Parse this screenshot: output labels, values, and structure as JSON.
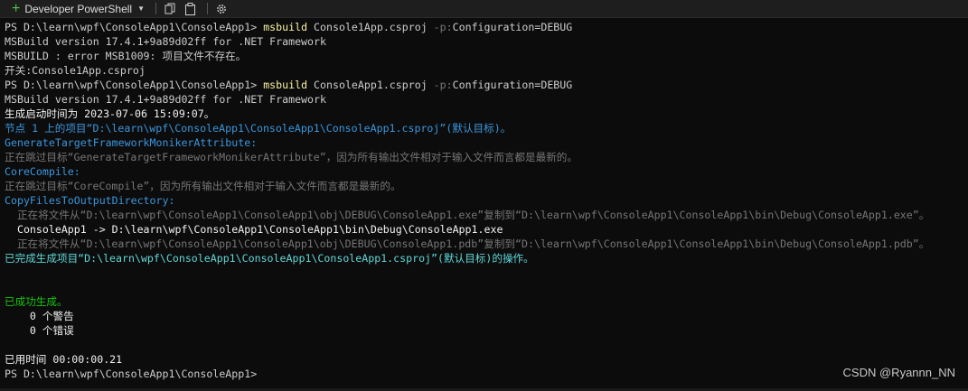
{
  "toolbar": {
    "new_tab_icon": "plus-icon",
    "profile_name": "Developer PowerShell",
    "dropdown_icon": "chevron-down-icon",
    "copy_icon": "copy-icon",
    "paste_icon": "paste-icon",
    "settings_icon": "gear-icon"
  },
  "terminal": {
    "lines": [
      [
        {
          "t": "PS D:\\learn\\wpf\\ConsoleApp1\\ConsoleApp1> ",
          "c": "w"
        },
        {
          "t": "msbuild",
          "c": "y"
        },
        {
          "t": " Console1App.csproj ",
          "c": "w"
        },
        {
          "t": "-p:",
          "c": "g"
        },
        {
          "t": "Configuration=DEBUG",
          "c": "w"
        }
      ],
      [
        {
          "t": "MSBuild version 17.4.1+9a89d02ff for .NET Framework",
          "c": "w"
        }
      ],
      [
        {
          "t": "MSBUILD : error MSB1009: 项目文件不存在。",
          "c": "w"
        }
      ],
      [
        {
          "t": "开关:Console1App.csproj",
          "c": "w"
        }
      ],
      [
        {
          "t": "PS D:\\learn\\wpf\\ConsoleApp1\\ConsoleApp1> ",
          "c": "w"
        },
        {
          "t": "msbuild",
          "c": "y"
        },
        {
          "t": " ConsoleApp1.csproj ",
          "c": "w"
        },
        {
          "t": "-p:",
          "c": "g"
        },
        {
          "t": "Configuration=DEBUG",
          "c": "w"
        }
      ],
      [
        {
          "t": "MSBuild version 17.4.1+9a89d02ff for .NET Framework",
          "c": "w"
        }
      ],
      [
        {
          "t": "生成启动时间为 2023-07-06 15:09:07。",
          "c": "wb"
        }
      ],
      [
        {
          "t": "节点 1 上的项目“D:\\learn\\wpf\\ConsoleApp1\\ConsoleApp1\\ConsoleApp1.csproj”(默认目标)。",
          "c": "c"
        }
      ],
      [
        {
          "t": "GenerateTargetFrameworkMonikerAttribute:",
          "c": "c"
        }
      ],
      [
        {
          "t": "正在跳过目标“GenerateTargetFrameworkMonikerAttribute”，因为所有输出文件相对于输入文件而言都是最新的。",
          "c": "g"
        }
      ],
      [
        {
          "t": "CoreCompile:",
          "c": "c"
        }
      ],
      [
        {
          "t": "正在跳过目标“CoreCompile”，因为所有输出文件相对于输入文件而言都是最新的。",
          "c": "g"
        }
      ],
      [
        {
          "t": "CopyFilesToOutputDirectory:",
          "c": "c"
        }
      ],
      [
        {
          "t": "  正在将文件从“D:\\learn\\wpf\\ConsoleApp1\\ConsoleApp1\\obj\\DEBUG\\ConsoleApp1.exe”复制到“D:\\learn\\wpf\\ConsoleApp1\\ConsoleApp1\\bin\\Debug\\ConsoleApp1.exe”。",
          "c": "g"
        }
      ],
      [
        {
          "t": "  ConsoleApp1 -> D:\\learn\\wpf\\ConsoleApp1\\ConsoleApp1\\bin\\Debug\\ConsoleApp1.exe",
          "c": "wb"
        }
      ],
      [
        {
          "t": "  正在将文件从“D:\\learn\\wpf\\ConsoleApp1\\ConsoleApp1\\obj\\DEBUG\\ConsoleApp1.pdb”复制到“D:\\learn\\wpf\\ConsoleApp1\\ConsoleApp1\\bin\\Debug\\ConsoleApp1.pdb”。",
          "c": "g"
        }
      ],
      [
        {
          "t": "已完成生成项目“D:\\learn\\wpf\\ConsoleApp1\\ConsoleApp1\\ConsoleApp1.csproj”(默认目标)的操作。",
          "c": "cb"
        }
      ],
      [],
      [],
      [
        {
          "t": "已成功生成。",
          "c": "gr"
        }
      ],
      [
        {
          "t": "    0 个警告",
          "c": "wb"
        }
      ],
      [
        {
          "t": "    0 个错误",
          "c": "wb"
        }
      ],
      [],
      [
        {
          "t": "已用时间 00:00:00.21",
          "c": "wb"
        }
      ],
      [
        {
          "t": "PS D:\\learn\\wpf\\ConsoleApp1\\ConsoleApp1>",
          "c": "w"
        }
      ]
    ]
  },
  "watermark": "CSDN @Ryannn_NN"
}
